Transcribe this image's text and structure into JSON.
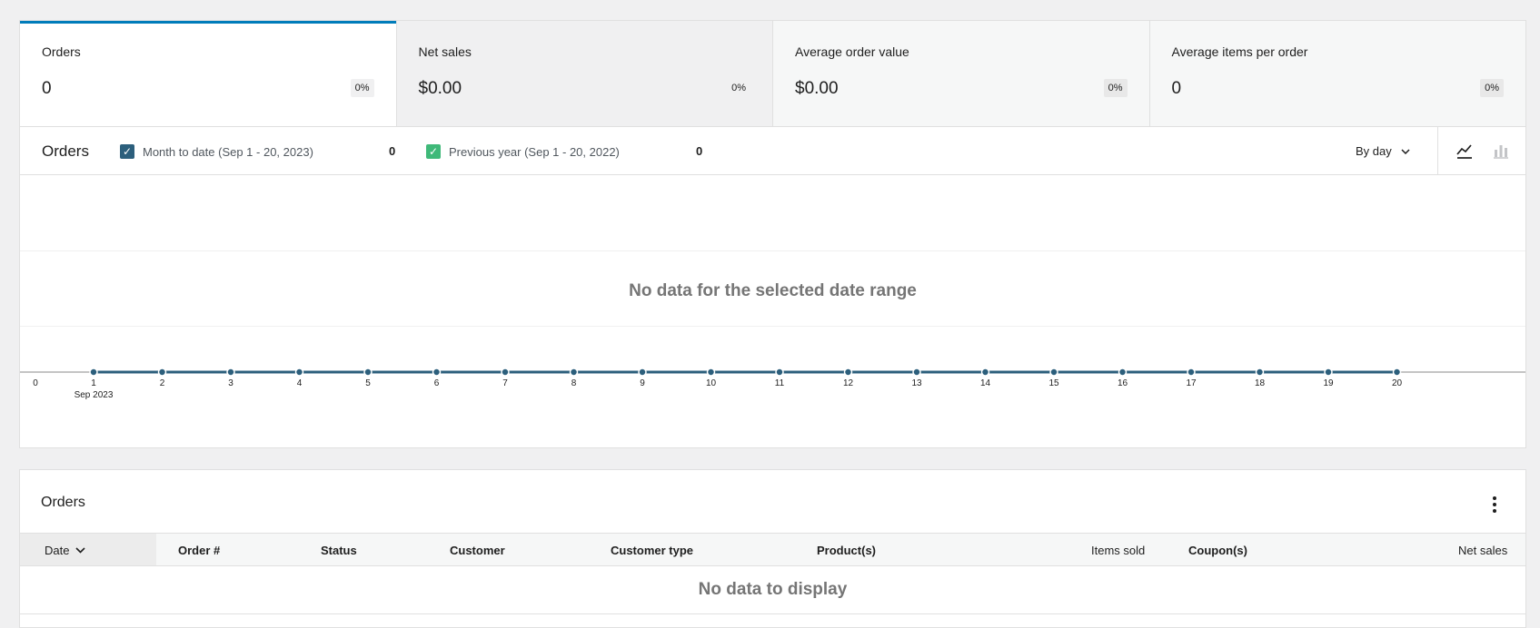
{
  "tiles": [
    {
      "label": "Orders",
      "value": "0",
      "delta": "0%"
    },
    {
      "label": "Net sales",
      "value": "$0.00",
      "delta": "0%"
    },
    {
      "label": "Average order value",
      "value": "$0.00",
      "delta": "0%"
    },
    {
      "label": "Average items per order",
      "value": "0",
      "delta": "0%"
    }
  ],
  "chart": {
    "title": "Orders",
    "legend": [
      {
        "label": "Month to date (Sep 1 - 20, 2023)",
        "total": "0",
        "color": "#2c5f7c"
      },
      {
        "label": "Previous year (Sep 1 - 20, 2022)",
        "total": "0",
        "color": "#3fb979"
      }
    ],
    "interval": "By day",
    "chart_type_icons": [
      "line-chart-icon",
      "bar-chart-icon"
    ],
    "no_data": "No data for the selected date range"
  },
  "chart_data": {
    "type": "line",
    "title": "",
    "xlabel": "",
    "ylabel": "",
    "x": [
      "1",
      "2",
      "3",
      "4",
      "5",
      "6",
      "7",
      "8",
      "9",
      "10",
      "11",
      "12",
      "13",
      "14",
      "15",
      "16",
      "17",
      "18",
      "19",
      "20"
    ],
    "x_ticks": [
      "0",
      "1",
      "2",
      "3",
      "4",
      "5",
      "6",
      "7",
      "8",
      "9",
      "10",
      "11",
      "12",
      "13",
      "14",
      "15",
      "16",
      "17",
      "18",
      "19",
      "20"
    ],
    "x_sublabel": "Sep 2023",
    "series": [
      {
        "values": [
          0,
          0,
          0,
          0,
          0,
          0,
          0,
          0,
          0,
          0,
          0,
          0,
          0,
          0,
          0,
          0,
          0,
          0,
          0,
          0
        ],
        "color": "#2c5f7c"
      }
    ],
    "grid": true
  },
  "table": {
    "title": "Orders",
    "columns": [
      "Date",
      "Order #",
      "Status",
      "Customer",
      "Customer type",
      "Product(s)",
      "Items sold",
      "Coupon(s)",
      "Net sales"
    ],
    "no_data": "No data to display"
  }
}
